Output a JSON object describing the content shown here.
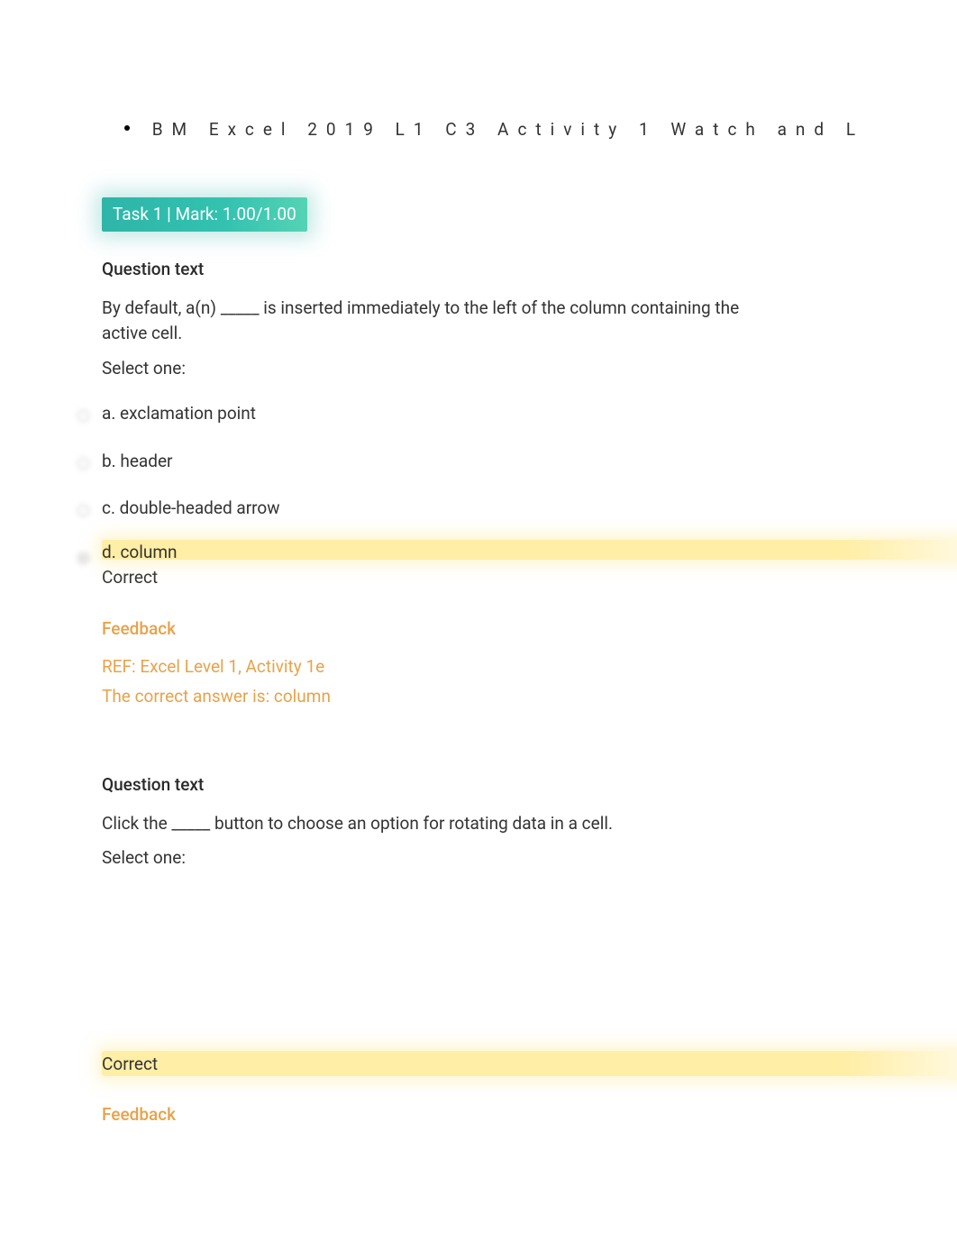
{
  "breadcrumb": {
    "title": "BM Excel 2019 L1 C3 Activity 1 Watch and L"
  },
  "task_badge": "Task 1 | Mark: 1.00/1.00",
  "question1": {
    "heading": "Question text",
    "body": "By default, a(n) _____ is inserted immediately to the left of the column containing the active cell.",
    "select_label": "Select one:",
    "options": {
      "a": "a. exclamation point",
      "b": "b. header",
      "c": "c. double-headed arrow",
      "d": "d. column"
    },
    "correct_label": "Correct",
    "feedback": {
      "heading": "Feedback",
      "ref": "REF: Excel Level 1, Activity 1e",
      "answer": "The correct answer is: column"
    }
  },
  "question2": {
    "heading": "Question text",
    "body": "Click the _____ button to choose an option for rotating data in a cell.",
    "select_label": "Select one:",
    "correct_label": "Correct",
    "feedback": {
      "heading": "Feedback"
    }
  }
}
